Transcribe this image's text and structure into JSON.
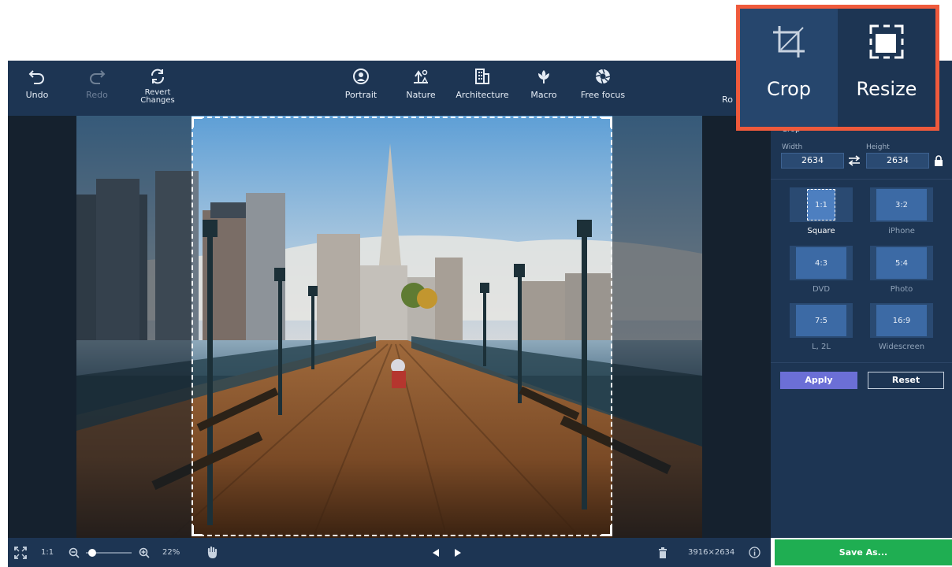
{
  "toolbar": {
    "undo": "Undo",
    "redo": "Redo",
    "revert_1": "Revert",
    "revert_2": "Changes",
    "portrait": "Portrait",
    "nature": "Nature",
    "architecture": "Architecture",
    "macro": "Macro",
    "free_focus": "Free focus",
    "rotate_partial": "Ro"
  },
  "callout": {
    "crop": "Crop",
    "resize": "Resize"
  },
  "panel": {
    "section": "Crop",
    "width_label": "Width",
    "height_label": "Height",
    "width_value": "2634",
    "height_value": "2634",
    "presets": [
      {
        "ratio": "1:1",
        "name": "Square"
      },
      {
        "ratio": "3:2",
        "name": "iPhone"
      },
      {
        "ratio": "4:3",
        "name": "DVD"
      },
      {
        "ratio": "5:4",
        "name": "Photo"
      },
      {
        "ratio": "7:5",
        "name": "L, 2L"
      },
      {
        "ratio": "16:9",
        "name": "Widescreen"
      }
    ],
    "apply": "Apply",
    "reset": "Reset"
  },
  "bottom": {
    "actual_size": "1:1",
    "zoom": "22%",
    "dimensions": "3916×2634",
    "save": "Save As..."
  },
  "colors": {
    "toolbar_bg": "#1d3553",
    "accent_highlight": "#ef5a3c",
    "save_green": "#1fae52",
    "apply_purple": "#6b6fd6"
  },
  "icons": [
    "undo-icon",
    "redo-icon",
    "revert-icon",
    "portrait-icon",
    "nature-icon",
    "architecture-icon",
    "macro-icon",
    "free-focus-icon",
    "crop-icon",
    "resize-icon",
    "swap-icon",
    "lock-icon",
    "fullscreen-icon",
    "zoom-out-icon",
    "zoom-in-icon",
    "hand-icon",
    "prev-icon",
    "next-icon",
    "trash-icon",
    "info-icon"
  ]
}
